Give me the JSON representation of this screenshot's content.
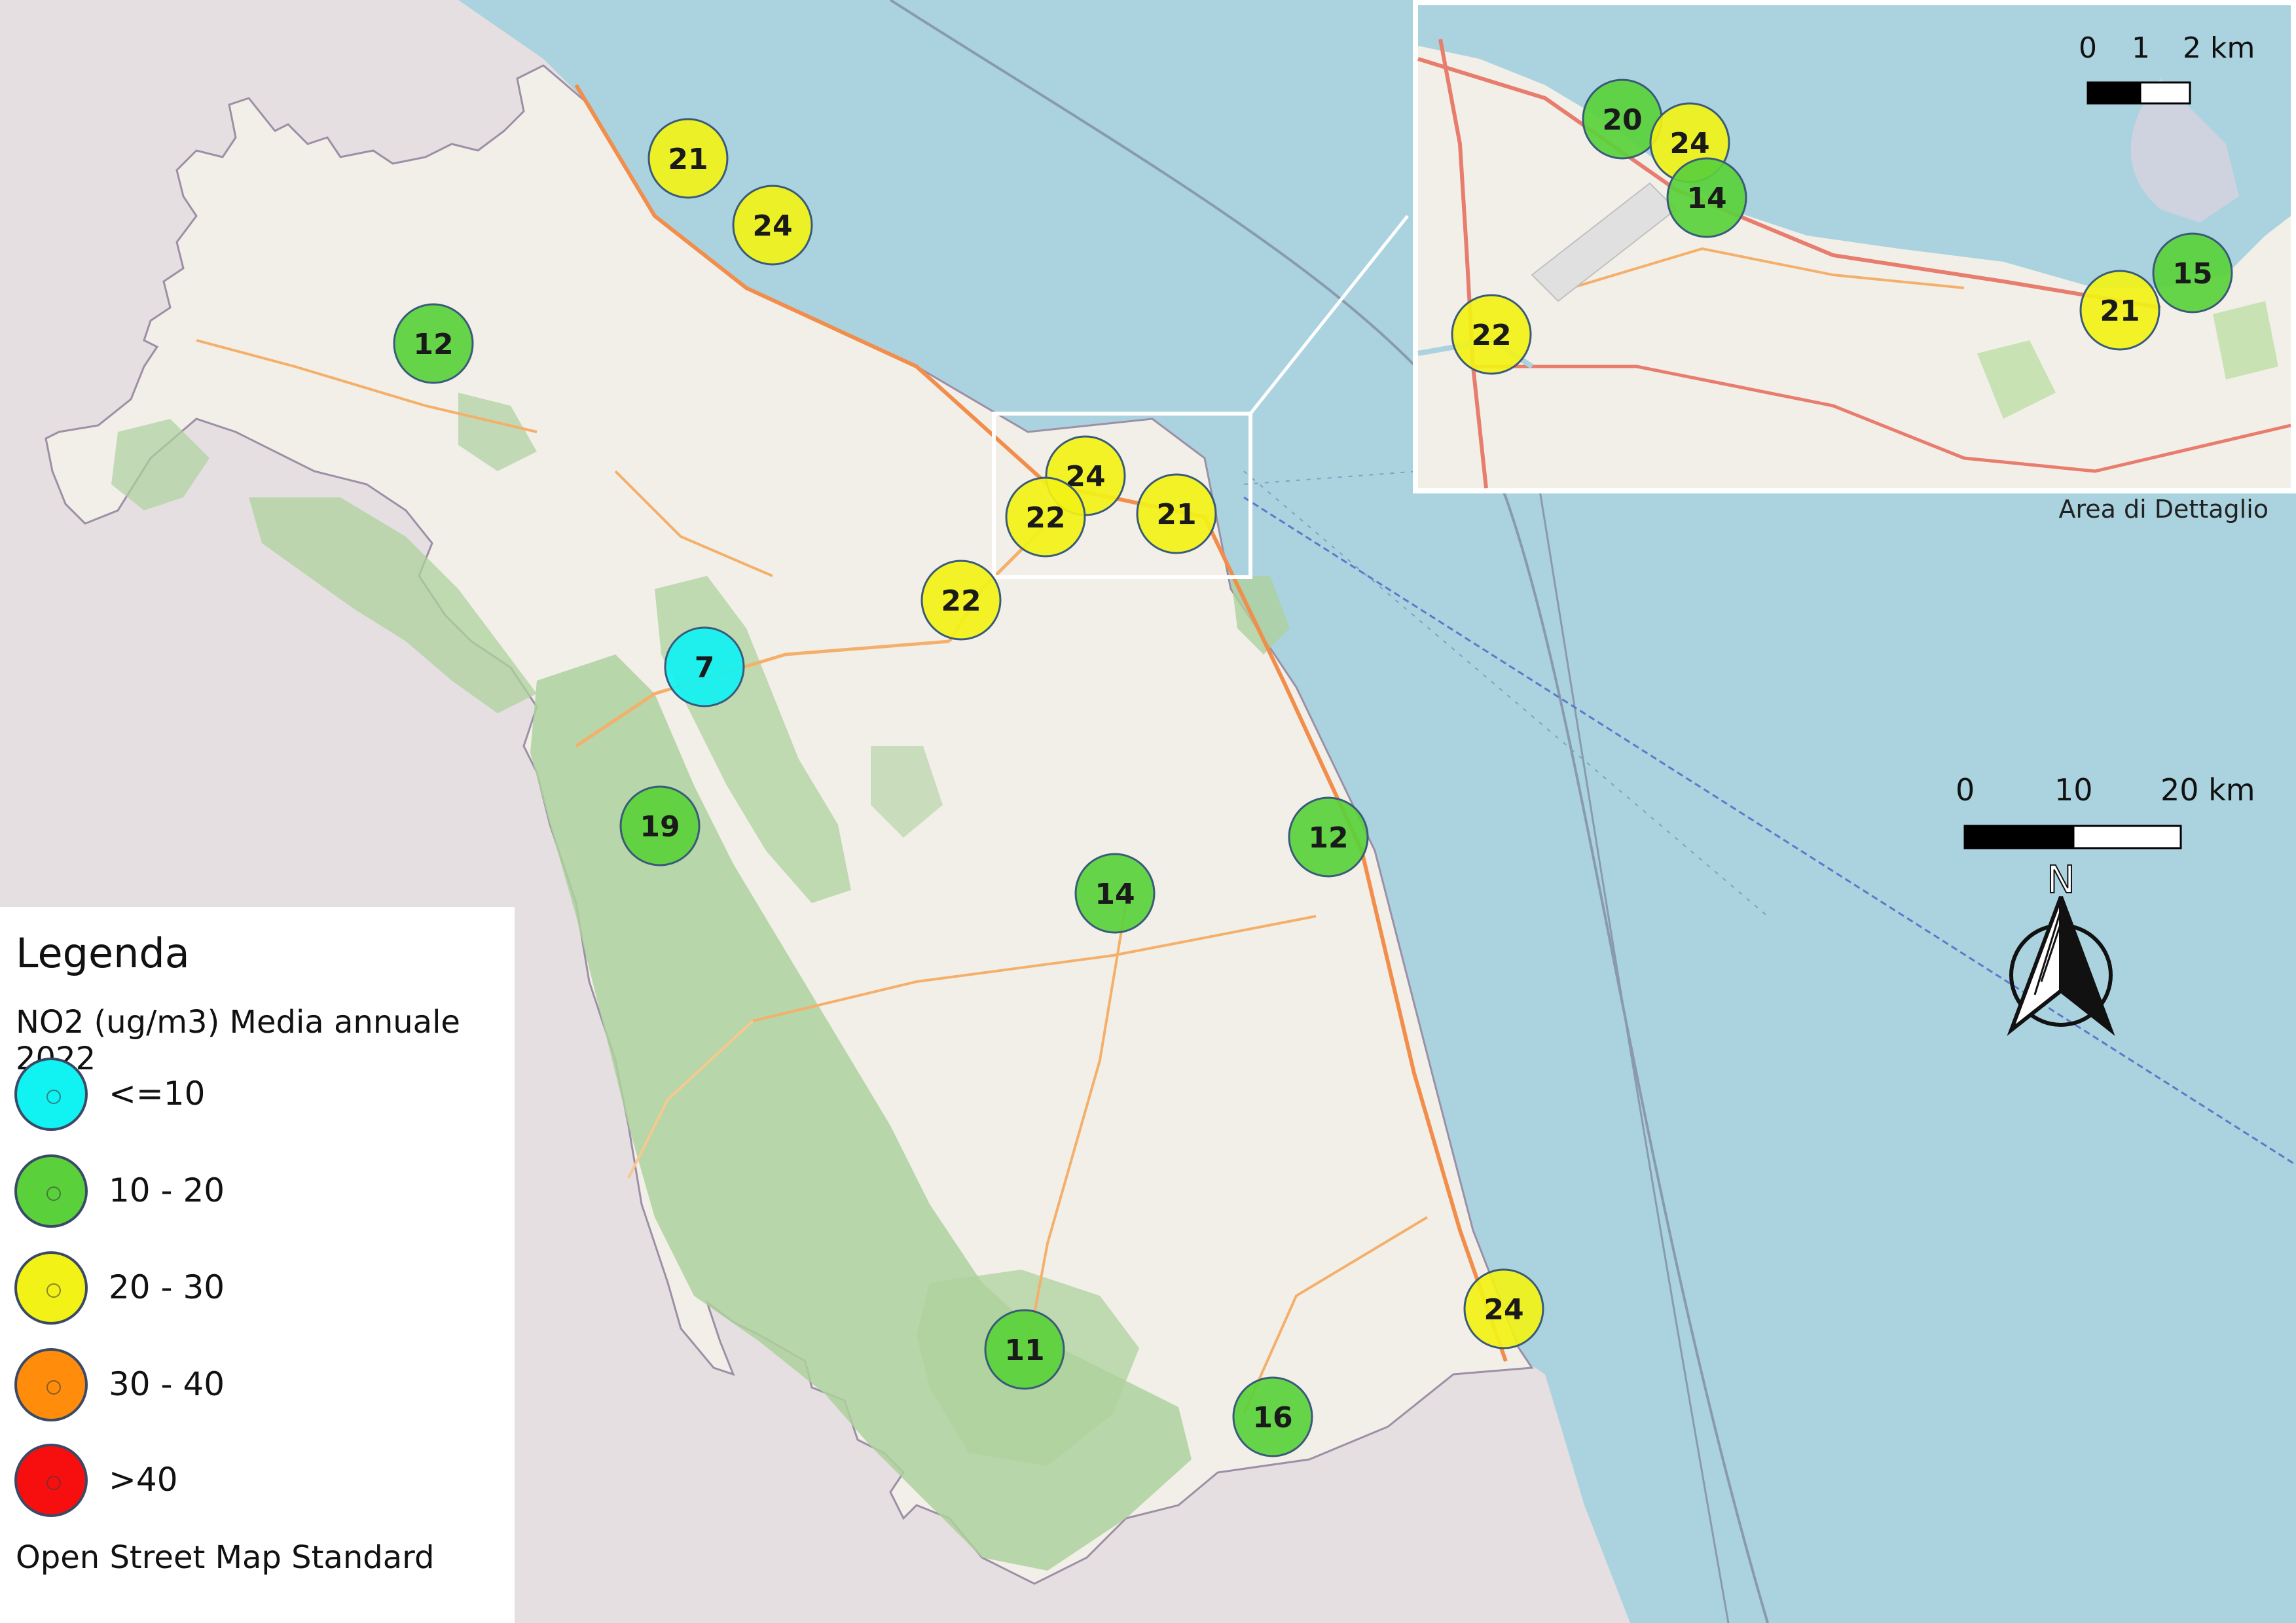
{
  "legend": {
    "title": "Legenda",
    "subtitle": "NO2 (ug/m3) Media annuale 2022",
    "classes": [
      {
        "label": "<=10",
        "color": "#11f2f2"
      },
      {
        "label": "10 - 20",
        "color": "#5ad13a"
      },
      {
        "label": "20 - 30",
        "color": "#f2f216"
      },
      {
        "label": "30 - 40",
        "color": "#ff8c0a"
      },
      {
        "label": ">40",
        "color": "#f70f0f"
      }
    ],
    "basemap": "Open Street Map Standard"
  },
  "inset": {
    "caption": "Area di Dettaglio"
  },
  "scale_bar": {
    "labels": [
      "0",
      "10",
      "20 km"
    ]
  },
  "inset_scale_bar": {
    "labels": [
      "0",
      "1",
      "2 km"
    ]
  },
  "north_arrow": {
    "label": "N"
  },
  "colors": {
    "sea": "#aad3df",
    "land": "#f2efe9",
    "outside": "#e6dfe2",
    "forest": "#add19e",
    "road": "#f28e4b"
  },
  "stations": [
    {
      "value": "21",
      "cls": 2
    },
    {
      "value": "24",
      "cls": 2
    },
    {
      "value": "12",
      "cls": 1
    },
    {
      "value": "24",
      "cls": 2
    },
    {
      "value": "22",
      "cls": 2
    },
    {
      "value": "21",
      "cls": 2
    },
    {
      "value": "22",
      "cls": 2
    },
    {
      "value": "7",
      "cls": 0
    },
    {
      "value": "19",
      "cls": 1
    },
    {
      "value": "14",
      "cls": 1
    },
    {
      "value": "12",
      "cls": 1
    },
    {
      "value": "24",
      "cls": 2
    },
    {
      "value": "11",
      "cls": 1
    },
    {
      "value": "16",
      "cls": 1
    }
  ],
  "inset_stations": [
    {
      "value": "20",
      "cls": 1
    },
    {
      "value": "24",
      "cls": 2
    },
    {
      "value": "14",
      "cls": 1
    },
    {
      "value": "22",
      "cls": 2
    },
    {
      "value": "21",
      "cls": 2
    },
    {
      "value": "15",
      "cls": 1
    }
  ]
}
